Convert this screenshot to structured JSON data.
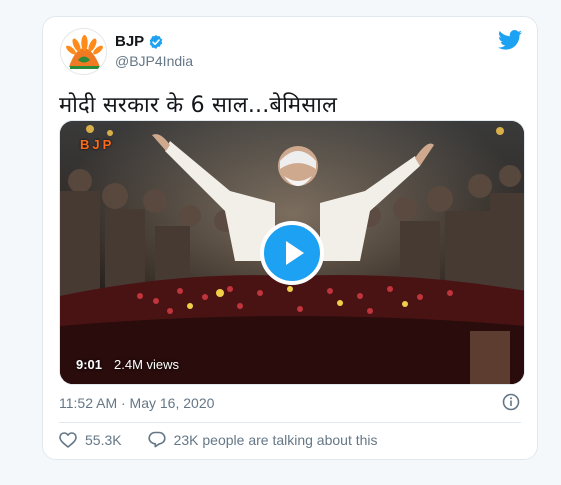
{
  "tweet": {
    "author_name": "BJP",
    "author_handle": "@BJP4India",
    "verified_icon": "verified-badge-icon",
    "text": "मोदी सरकार के 6 साल...बेमिसाल",
    "media": {
      "watermark": "BJP",
      "duration": "9:01",
      "views": "2.4M views"
    },
    "timestamp": "11:52 AM · May 16, 2020",
    "likes": "55.3K",
    "talking": "23K people are talking about this"
  },
  "colors": {
    "accent": "#1da1f2",
    "text_primary": "#14171a",
    "text_secondary": "#657786",
    "border": "#e1e8ed"
  },
  "icons": [
    "bjp-avatar-icon",
    "verified-badge-icon",
    "twitter-bird-icon",
    "play-icon",
    "info-icon",
    "heart-icon",
    "comment-icon"
  ]
}
